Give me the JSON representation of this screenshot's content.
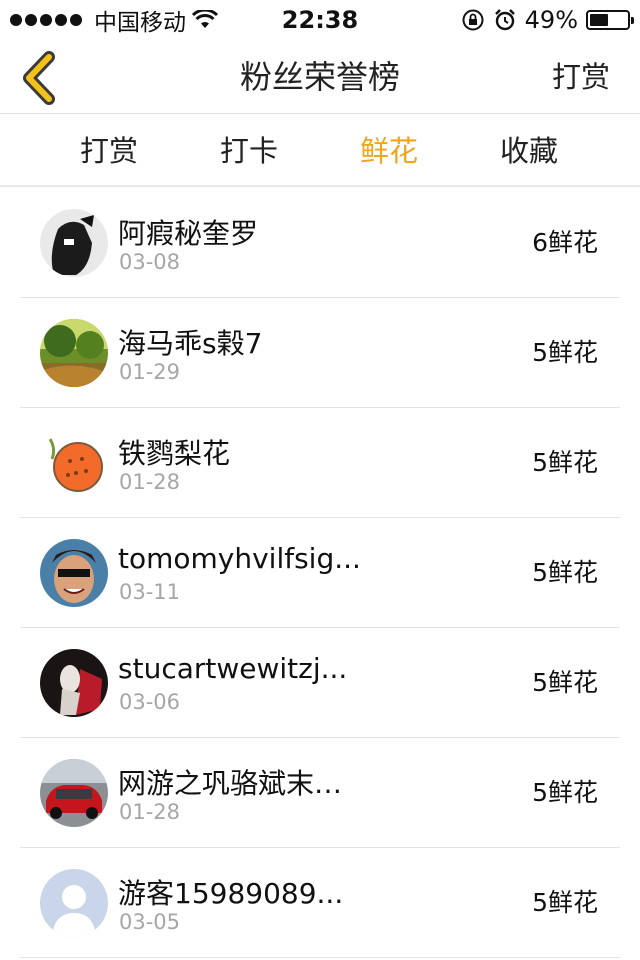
{
  "status_bar": {
    "carrier": "中国移动",
    "time": "22:38",
    "battery": "49%",
    "battery_level": 0.49,
    "icons": [
      "signal-dots-icon",
      "wifi-icon",
      "rotation-lock-icon",
      "alarm-icon",
      "battery-icon"
    ]
  },
  "nav": {
    "back_icon": "chevron-left-icon",
    "title": "粉丝荣誉榜",
    "action": "打赏",
    "accent_color": "#f2c21a"
  },
  "tabs": [
    {
      "label": "打赏",
      "active": false
    },
    {
      "label": "打卡",
      "active": false
    },
    {
      "label": "鲜花",
      "active": true
    },
    {
      "label": "收藏",
      "active": false
    }
  ],
  "tab_active_color": "#f2a51a",
  "fans": [
    {
      "name": "阿瘕秘奎罗",
      "date": "03-08",
      "count": "6鲜花",
      "avatar": "dark-figure-avatar"
    },
    {
      "name": "海马乖s榖7",
      "date": "01-29",
      "count": "5鲜花",
      "avatar": "forest-avatar"
    },
    {
      "name": "铁鹨梨花",
      "date": "01-28",
      "count": "5鲜花",
      "avatar": "orange-cartoon-avatar"
    },
    {
      "name": "tomomyhvilfsig...",
      "date": "03-11",
      "count": "5鲜花",
      "avatar": "cartoon-face-avatar"
    },
    {
      "name": "stucartwewitzj...",
      "date": "03-06",
      "count": "5鲜花",
      "avatar": "figure-red-avatar"
    },
    {
      "name": "网游之巩骆斌末…",
      "date": "01-28",
      "count": "5鲜花",
      "avatar": "red-car-avatar"
    },
    {
      "name": "游客15989089...",
      "date": "03-05",
      "count": "5鲜花",
      "avatar": "default-user-avatar"
    }
  ]
}
